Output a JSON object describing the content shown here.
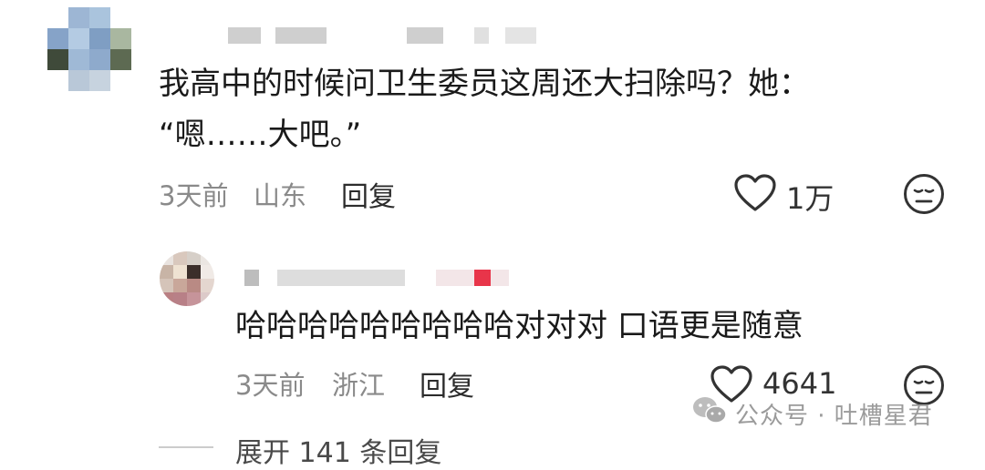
{
  "comments": [
    {
      "text_line1": "我高中的时候问卫生委员这周还大扫除吗？她：",
      "text_line2": "“嗯……大吧。”",
      "time": "3天前",
      "location": "山东",
      "reply_label": "回复",
      "likes": "1万"
    },
    {
      "text": "哈哈哈哈哈哈哈哈哈对对对 口语更是随意",
      "time": "3天前",
      "location": "浙江",
      "reply_label": "回复",
      "likes": "4641"
    }
  ],
  "expand_replies": "展开 141 条回复",
  "watermark": {
    "text": "公众号 · 吐槽星君",
    "icon": "wechat-icon"
  },
  "icons": {
    "like": "heart-outline-icon",
    "dislike": "neutral-face-icon"
  },
  "colors": {
    "text": "#1a1a1a",
    "meta": "#8a8a8a",
    "blur": "#cfcfcf",
    "tag_red": "#e8354a"
  }
}
